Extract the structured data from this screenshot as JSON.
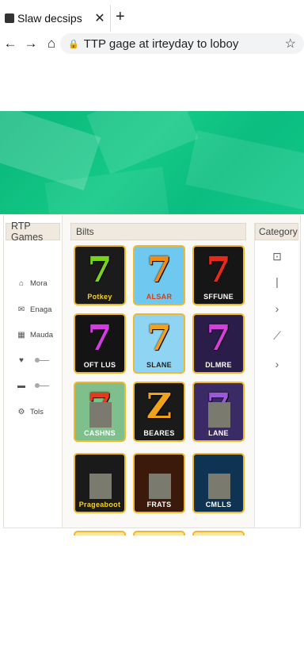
{
  "browser": {
    "tab_title": "Slaw decsips",
    "url": "TTP gage at irteyday to loboy",
    "icons": {
      "close": "close-icon",
      "new_tab": "plus-icon",
      "back": "back-arrow-icon",
      "forward": "forward-arrow-icon",
      "home": "home-icon",
      "lock": "lock-icon",
      "bookmark": "star-icon"
    }
  },
  "hero": {
    "color": "#12c486"
  },
  "left_sidebar": {
    "header": "RTP Games",
    "items": [
      {
        "label": "Mora",
        "icon": "home-icon"
      },
      {
        "label": "Enaga",
        "icon": "mail-icon"
      },
      {
        "label": "Mauda",
        "icon": "grid-icon"
      },
      {
        "label": "",
        "icon": "heart-icon"
      },
      {
        "label": "",
        "icon": "card-icon"
      },
      {
        "label": "Tols",
        "icon": "tools-icon"
      }
    ]
  },
  "games": {
    "header": "Bilts",
    "tiles": [
      {
        "label": "Potkey",
        "seven_color": "#7ad31c",
        "bg": "#1b1b1b",
        "label_color": "#f5d21b"
      },
      {
        "label": "ALSAR",
        "seven_color": "#f48a12",
        "bg": "#6fc8ef",
        "label_color": "#e03a12"
      },
      {
        "label": "SFFUNE",
        "seven_color": "#e52a1c",
        "bg": "#161616",
        "label_color": "#ffffff"
      },
      {
        "label": "OFT LUS",
        "seven_color": "#d43be0",
        "bg": "#141414",
        "label_color": "#ffffff"
      },
      {
        "label": "SLANE",
        "seven_color": "#f2a11a",
        "bg": "#8fd4f3",
        "label_color": "#222222"
      },
      {
        "label": "DLMRE",
        "seven_color": "#d63fd8",
        "bg": "#2a1d4a",
        "label_color": "#ffffff"
      },
      {
        "label": "CASHNS",
        "seven_color": "#e63a1a",
        "bg": "#7fbf8b",
        "label_color": "#ffffff"
      },
      {
        "label": "BEARES",
        "seven_color": "#f0a21a",
        "bg": "#1a1a1a",
        "label_color": "#ffffff"
      },
      {
        "label": "LANE",
        "seven_color": "#9a5ad6",
        "bg": "#3a2a66",
        "label_color": "#ffffff"
      },
      {
        "label": "Prageaboot",
        "seven_color": "#e8421a",
        "bg": "#1a1a1a",
        "label_color": "#f5d21b"
      },
      {
        "label": "FRATS",
        "seven_color": "#f08a1a",
        "bg": "#3b1a0c",
        "label_color": "#ffffff"
      },
      {
        "label": "CMLLS",
        "seven_color": "#f5a01a",
        "bg": "#0f3352",
        "label_color": "#ffffff"
      }
    ]
  },
  "right_sidebar": {
    "header": "Category",
    "icons": [
      "info-icon",
      "divider-line-icon",
      "chevron-right-icon",
      "trend-icon",
      "chevron-right-icon"
    ]
  }
}
